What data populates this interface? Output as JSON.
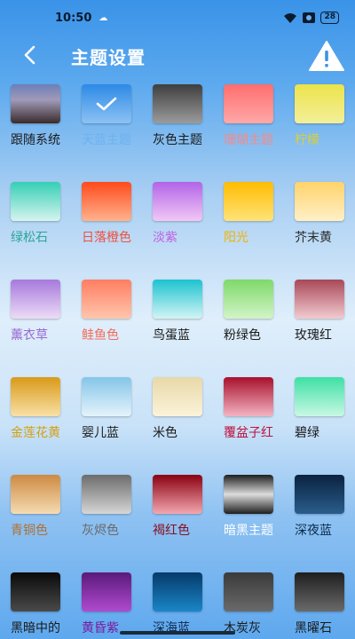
{
  "status": {
    "time": "10:50",
    "battery": "28"
  },
  "appbar": {
    "title": "主题设置"
  },
  "themes": [
    {
      "label": "跟随系统",
      "color": "#1a1a1a",
      "gradient": "linear-gradient(180deg,#6d7fb7 0%,#a09ab8 40%,#3a2b2b 100%)",
      "selected": false
    },
    {
      "label": "天蓝主题",
      "color": "#6cb2f2",
      "gradient": "linear-gradient(180deg,#2d8ae6 0%,#8cc2f3 100%)",
      "selected": true
    },
    {
      "label": "灰色主题",
      "color": "#1a1a1a",
      "gradient": "linear-gradient(180deg,#3e3e3e 0%,#9c9c9c 100%)",
      "selected": false
    },
    {
      "label": "珊瑚主题",
      "color": "#f58a8a",
      "gradient": "linear-gradient(180deg,#ff6e6e 0%,#ffa8a8 100%)",
      "selected": false
    },
    {
      "label": "柠檬",
      "color": "#d8cf3a",
      "gradient": "linear-gradient(180deg,#ece34a 0%,#f3ef9a 100%)",
      "selected": false
    },
    {
      "label": "绿松石",
      "color": "#2aa596",
      "gradient": "linear-gradient(180deg,#35cfb5 0%,#d6f4ee 100%)",
      "selected": false
    },
    {
      "label": "日落橙色",
      "color": "#f05040",
      "gradient": "linear-gradient(180deg,#ff4a1c 0%,#ffb38e 100%)",
      "selected": false
    },
    {
      "label": "淡紫",
      "color": "#c160e0",
      "gradient": "linear-gradient(180deg,#b264e8 0%,#f1c8f5 100%)",
      "selected": false
    },
    {
      "label": "阳光",
      "color": "#f0b400",
      "gradient": "linear-gradient(180deg,#ffbc00 0%,#ffe37a 100%)",
      "selected": false
    },
    {
      "label": "芥末黄",
      "color": "#2a2a2a",
      "gradient": "linear-gradient(180deg,#ffd36a 0%,#fff0c8 100%)",
      "selected": false
    },
    {
      "label": "薰衣草",
      "color": "#9a6ad4",
      "gradient": "linear-gradient(180deg,#a779dc 0%,#ecdcf6 100%)",
      "selected": false
    },
    {
      "label": "鲑鱼色",
      "color": "#f56b5a",
      "gradient": "linear-gradient(180deg,#ff7e62 0%,#ffc6ad 100%)",
      "selected": false
    },
    {
      "label": "鸟蛋蓝",
      "color": "#1a1a1a",
      "gradient": "linear-gradient(180deg,#1cc3d0 0%,#d3f4f4 100%)",
      "selected": false
    },
    {
      "label": "粉绿色",
      "color": "#1a1a1a",
      "gradient": "linear-gradient(180deg,#7ed96a 0%,#d3f4c8 100%)",
      "selected": false
    },
    {
      "label": "玫瑰红",
      "color": "#1a1a1a",
      "gradient": "linear-gradient(180deg,#a84858 0%,#f3cbd1 100%)",
      "selected": false
    },
    {
      "label": "金莲花黄",
      "color": "#d4a010",
      "gradient": "linear-gradient(180deg,#d99a18 0%,#f8e0a6 100%)",
      "selected": false
    },
    {
      "label": "婴儿蓝",
      "color": "#1a1a1a",
      "gradient": "linear-gradient(180deg,#85c5e8 0%,#e4f3fb 100%)",
      "selected": false
    },
    {
      "label": "米色",
      "color": "#1a1a1a",
      "gradient": "linear-gradient(180deg,#e8d8a8 0%,#fbf3da 100%)",
      "selected": false
    },
    {
      "label": "覆盆子红",
      "color": "#c0103c",
      "gradient": "linear-gradient(180deg,#a8102c 0%,#f3b3c2 100%)",
      "selected": false
    },
    {
      "label": "碧绿",
      "color": "#1a1a1a",
      "gradient": "linear-gradient(180deg,#3fe0a4 0%,#c8f8e4 100%)",
      "selected": false
    },
    {
      "label": "青铜色",
      "color": "#b07030",
      "gradient": "linear-gradient(180deg,#cd8a42 0%,#f5dbb3 100%)",
      "selected": false
    },
    {
      "label": "灰烬色",
      "color": "#6a6a6a",
      "gradient": "linear-gradient(180deg,#6c6c6c 0%,#d6d6d6 100%)",
      "selected": false
    },
    {
      "label": "褐红色",
      "color": "#8a1020",
      "gradient": "linear-gradient(180deg,#8a0010 0%,#f3a7b0 100%)",
      "selected": false
    },
    {
      "label": "暗黑主题",
      "color": "#ffffff",
      "gradient": "linear-gradient(180deg,#1e1e1e 0%,#dcdcdc 50%,#1e1e1e 100%)",
      "selected": false
    },
    {
      "label": "深夜蓝",
      "color": "#0b2a4a",
      "gradient": "linear-gradient(180deg,#0a2240 0%,#2a5d8c 100%)",
      "selected": false
    },
    {
      "label": "黑暗中的黑",
      "color": "#1a1a1a",
      "gradient": "linear-gradient(180deg,#0a0a0a 0%,#4a4a4a 100%)",
      "selected": false
    },
    {
      "label": "黄昏紫",
      "color": "#7a1aa0",
      "gradient": "linear-gradient(180deg,#5a1a7a 0%,#b04ad0 100%)",
      "selected": false
    },
    {
      "label": "深海蓝",
      "color": "#0a2a50",
      "gradient": "linear-gradient(180deg,#053a6a 0%,#1a86c8 100%)",
      "selected": false
    },
    {
      "label": "木炭灰",
      "color": "#1a1a1a",
      "gradient": "linear-gradient(180deg,#3a3a3a 0%,#6a6a6a 100%)",
      "selected": false
    },
    {
      "label": "黑曜石",
      "color": "#1a1a1a",
      "gradient": "linear-gradient(180deg,#1e1e1e 0%,#6a6a6a 100%)",
      "selected": false
    }
  ]
}
